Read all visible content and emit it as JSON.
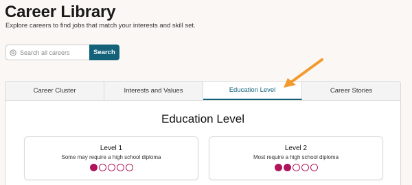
{
  "header": {
    "title": "Career Library",
    "subtitle": "Explore careers to find jobs that match your interests and skill set."
  },
  "search": {
    "placeholder": "Search all careers",
    "button_label": "Search",
    "icon": "search-icon"
  },
  "tabs": [
    {
      "label": "Career Cluster",
      "active": false
    },
    {
      "label": "Interests and Values",
      "active": false
    },
    {
      "label": "Education Level",
      "active": true
    },
    {
      "label": "Career Stories",
      "active": false
    }
  ],
  "section": {
    "title": "Education Level"
  },
  "levels": [
    {
      "name": "Level 1",
      "description": "Some may require a high school diploma",
      "rating": 1,
      "max": 5
    },
    {
      "name": "Level 2",
      "description": "Most require a high school diploma",
      "rating": 2,
      "max": 5
    }
  ],
  "colors": {
    "accent": "#13627a",
    "rating": "#b0155b",
    "annotation_arrow": "#f29a2e"
  }
}
